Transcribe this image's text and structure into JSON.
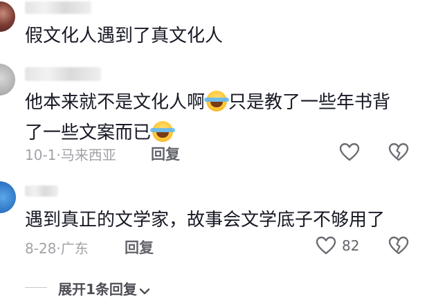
{
  "comments": [
    {
      "text": "假文化人遇到了真文化人"
    },
    {
      "line1": "他本来就不是文化人啊",
      "line1b": "只是教了一些年书背",
      "line2": "了一些文案而已",
      "emoji": "laughing-crying-emoji",
      "date": "10-1·",
      "location": "马来西亚",
      "reply_label": "回复"
    },
    {
      "text": "遇到真正的文学家，故事会文学底子不够用了",
      "date": "8-28·",
      "location": "广东",
      "reply_label": "回复",
      "like_count": "82"
    }
  ],
  "expand_label": "展开1条回复"
}
